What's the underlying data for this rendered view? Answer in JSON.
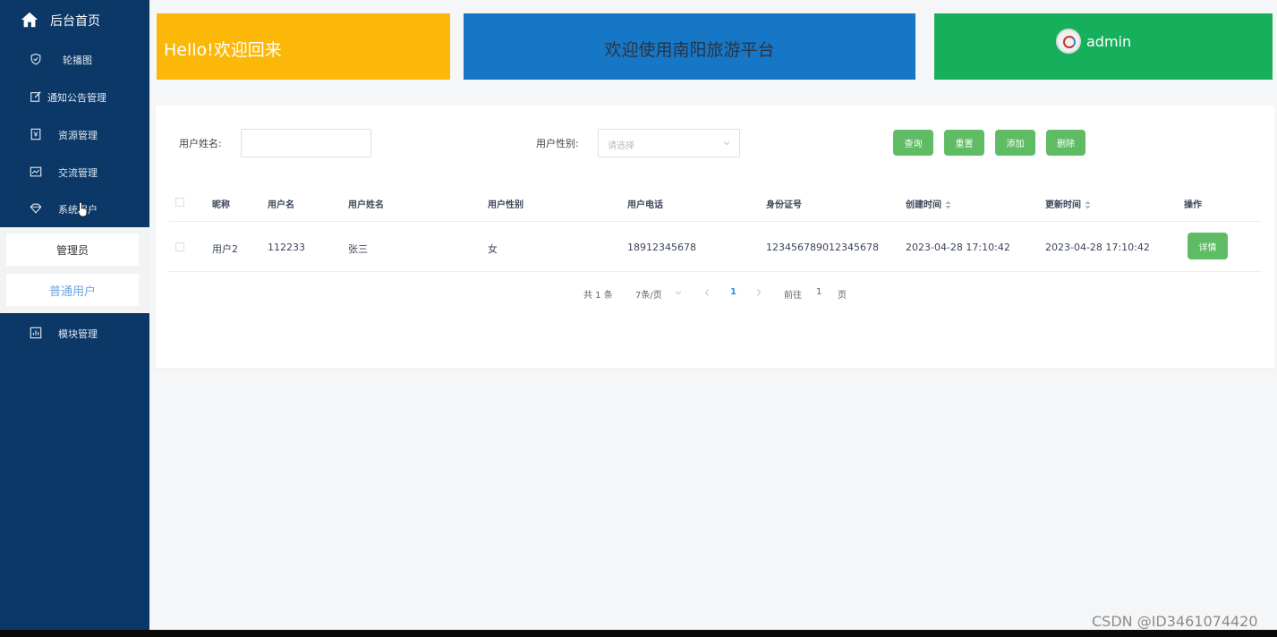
{
  "sidebar": {
    "home_label": "后台首页",
    "items": [
      {
        "label": "轮播图",
        "icon": "shield-check-icon"
      },
      {
        "label": "通知公告管理",
        "icon": "edit-icon"
      },
      {
        "label": "资源管理",
        "icon": "bookmark-icon"
      },
      {
        "label": "交流管理",
        "icon": "trend-chart-icon"
      },
      {
        "label": "系统用户",
        "icon": "gem-icon"
      },
      {
        "label": "模块管理",
        "icon": "bar-chart-icon"
      }
    ],
    "sub_items": [
      {
        "label": "管理员"
      },
      {
        "label": "普通用户"
      }
    ]
  },
  "cards": {
    "hello": "Hello!欢迎回来",
    "welcome": "欢迎使用南阳旅游平台",
    "admin": "admin"
  },
  "filter": {
    "name_label": "用户姓名:",
    "name_value": "",
    "gender_label": "用户性别:",
    "gender_placeholder": "请选择"
  },
  "buttons": {
    "query": "查询",
    "reset": "重置",
    "add": "添加",
    "delete": "删除"
  },
  "table": {
    "headers": [
      "昵称",
      "用户名",
      "用户姓名",
      "用户性别",
      "用户电话",
      "身份证号",
      "创建时间",
      "更新时间",
      "操作"
    ],
    "rows": [
      [
        "用户2",
        "112233",
        "张三",
        "女",
        "18912345678",
        "123456789012345678",
        "2023-04-28 17:10:42",
        "2023-04-28 17:10:42"
      ]
    ],
    "detail_label": "详情"
  },
  "pagination": {
    "total": "共 1 条",
    "page_size": "7条/页",
    "current": "1",
    "goto_label": "前往",
    "goto_value": "1",
    "page_unit": "页"
  },
  "watermark": "CSDN @ID3461074420",
  "colors": {
    "sidebar": "#0b3866",
    "hello_card": "#fbb809",
    "welcome_card": "#1777c7",
    "admin_card": "#16b05d",
    "button": "#5fbc64"
  }
}
